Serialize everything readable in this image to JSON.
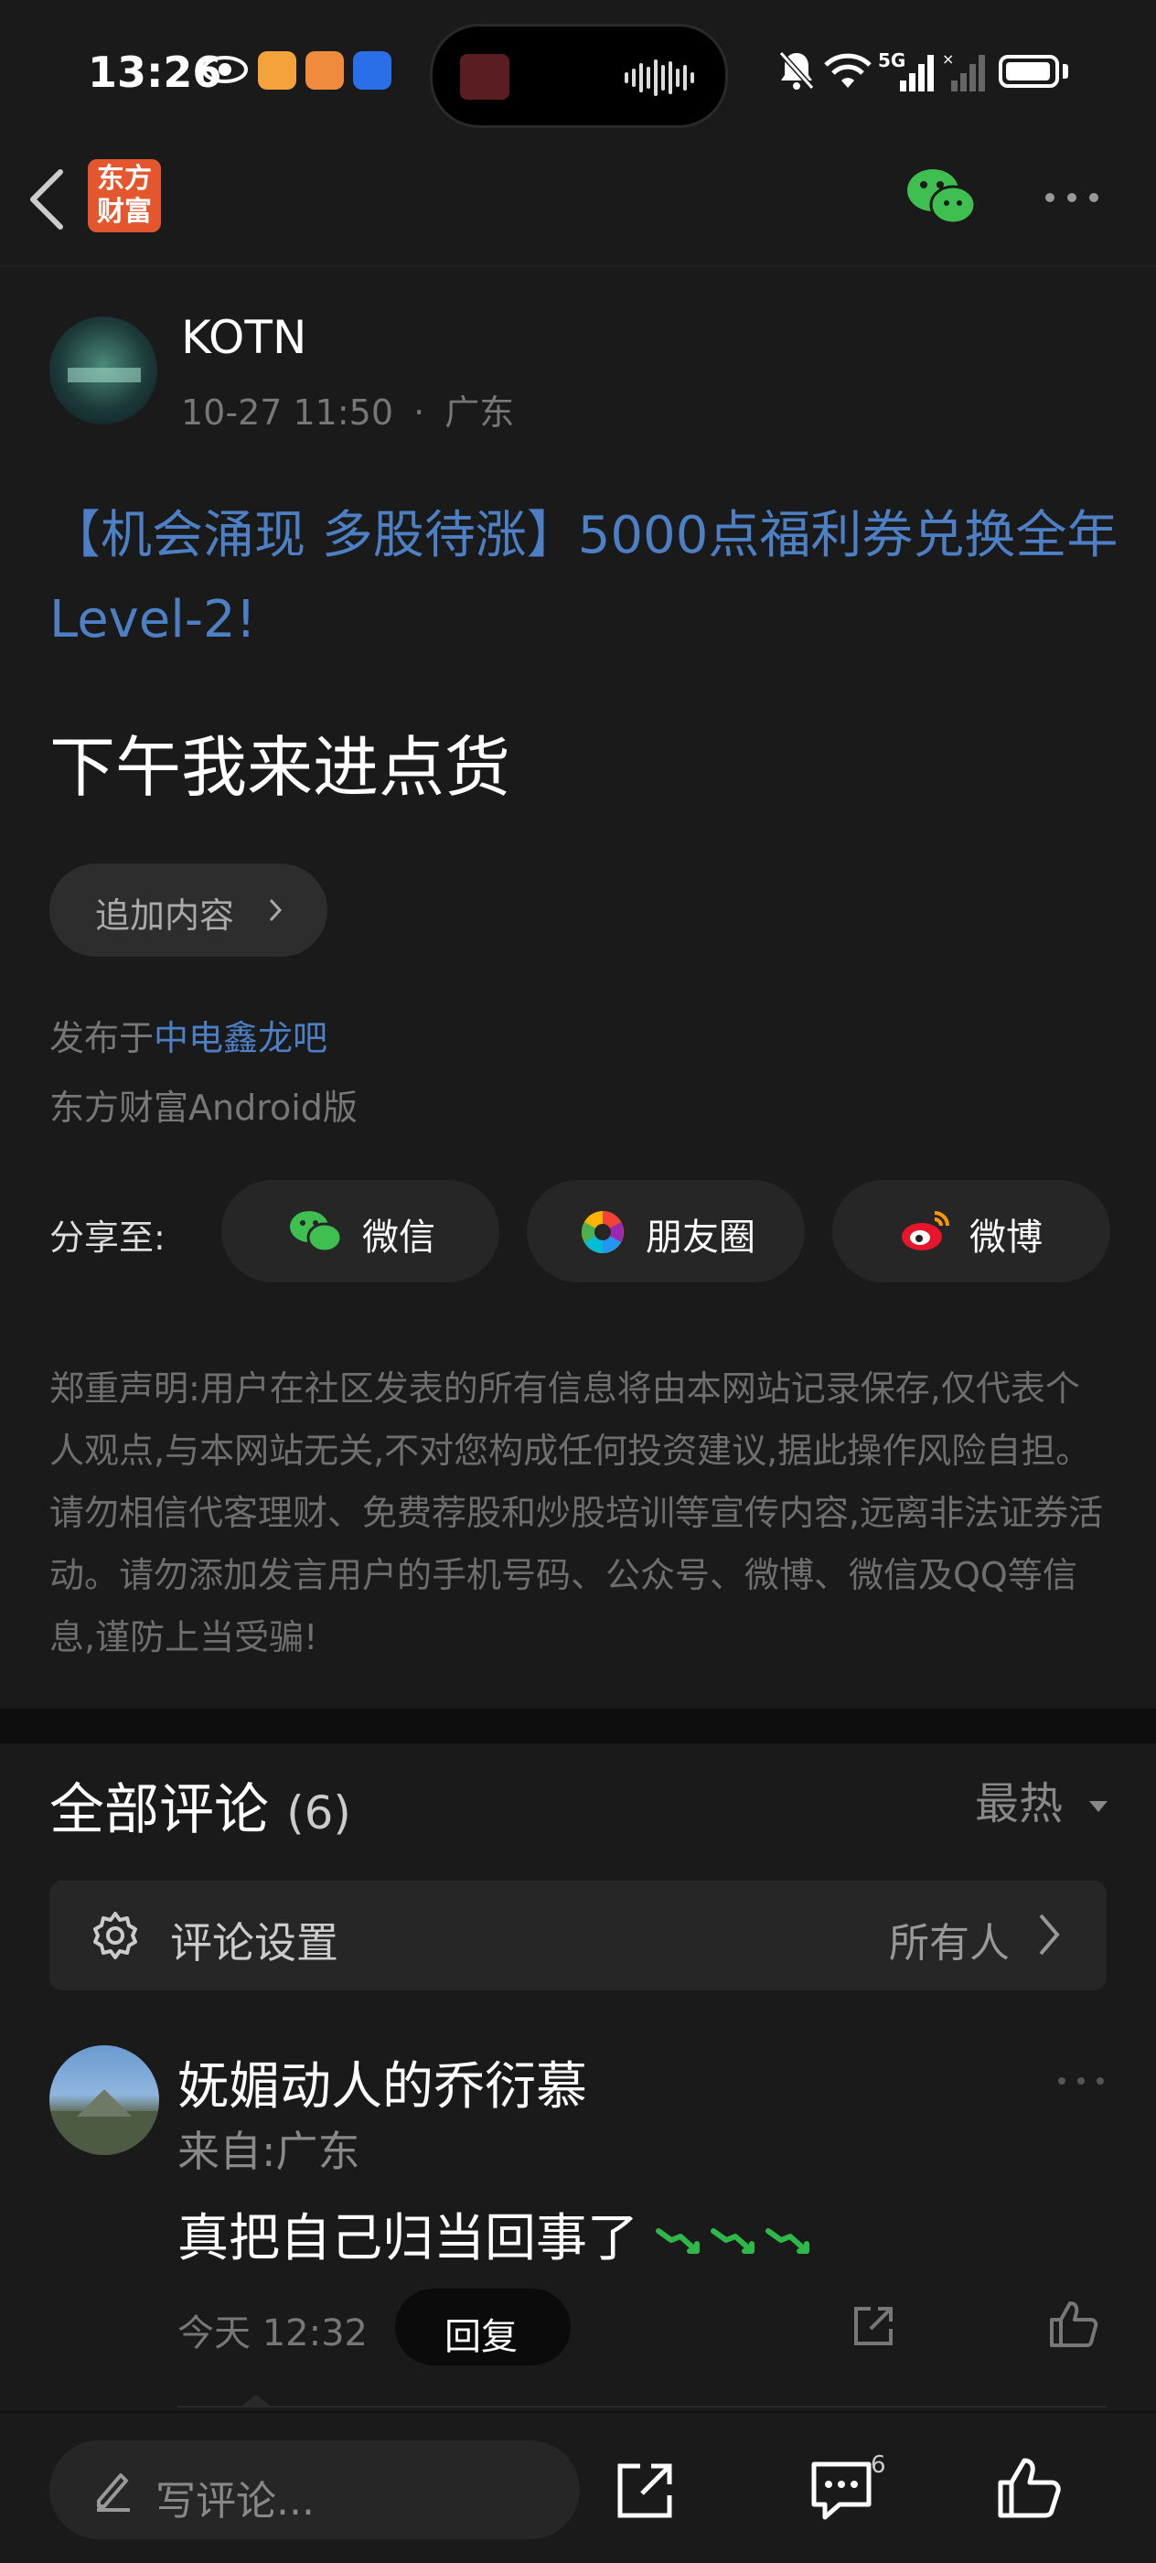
{
  "status_bar": {
    "time": "13:26",
    "network": "5G"
  },
  "top_nav": {
    "logo_text": "东方财富",
    "logo_color": "#e4572e",
    "icons": [
      "back-arrow-icon",
      "wechat-icon",
      "more-icon"
    ]
  },
  "post": {
    "author": "KOTN",
    "date": "10-27 11:50",
    "location": "广东",
    "meta_separator": "·",
    "promo_link": "【机会涌现 多股待涨】5000点福利券兑换全年Level-2!",
    "body": "下午我来进点货",
    "append_label": "追加内容",
    "published_prefix": "发布于",
    "forum": "中电鑫龙吧",
    "client": "东方财富Android版"
  },
  "share": {
    "label": "分享至:",
    "targets": [
      {
        "label": "微信",
        "icon": "wechat-icon"
      },
      {
        "label": "朋友圈",
        "icon": "moments-icon"
      },
      {
        "label": "微博",
        "icon": "weibo-icon"
      }
    ]
  },
  "disclaimer": "郑重声明:用户在社区发表的所有信息将由本网站记录保存,仅代表个人观点,与本网站无关,不对您构成任何投资建议,据此操作风险自担。请勿相信代客理财、免费荐股和炒股培训等宣传内容,远离非法证券活动。请勿添加发言用户的手机号码、公众号、微博、微信及QQ等信息,谨防上当受骗!",
  "comments": {
    "title": "全部评论",
    "count": "(6)",
    "sort": "最热",
    "settings_label": "评论设置",
    "settings_value": "所有人",
    "items": [
      {
        "name": "妩媚动人的乔衍慕",
        "location": "来自:广东",
        "text": "真把自己归当回事了",
        "time": "今天 12:32",
        "reply_label": "回复"
      }
    ]
  },
  "bottom_bar": {
    "placeholder": "写评论...",
    "comment_badge": "6"
  },
  "colors": {
    "background": "#1a1a1a",
    "link": "#4d7fc4",
    "wechat_green": "#3fbf4f",
    "down_trend_green": "#2fb84a"
  }
}
